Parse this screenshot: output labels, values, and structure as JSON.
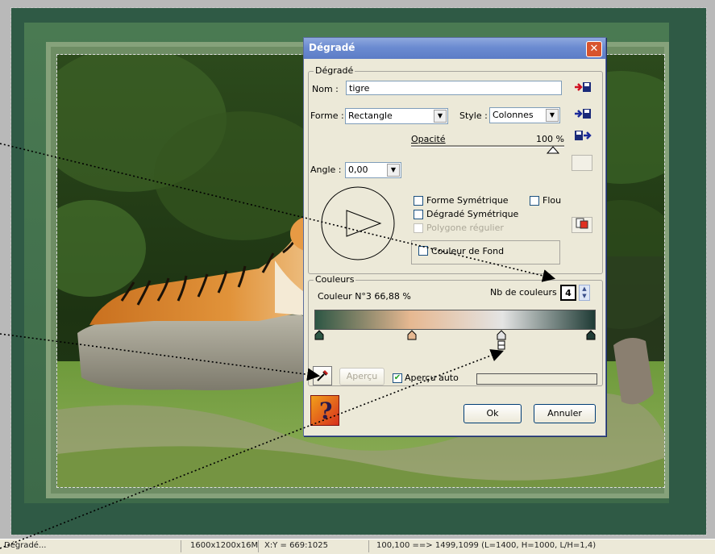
{
  "dialog": {
    "title": "Dégradé",
    "close_label": "✕",
    "gradient_group": {
      "label": "Dégradé",
      "name_label": "Nom :",
      "name_value": "tigre",
      "shape_label": "Forme :",
      "shape_value": "Rectangle",
      "style_label": "Style :",
      "style_value": "Colonnes",
      "opacity_label": "Opacité",
      "opacity_value": "100 %",
      "angle_label": "Angle :",
      "angle_value": "0,00",
      "symmetric_shape_label": "Forme Symétrique",
      "symmetric_shape_checked": false,
      "blur_label": "Flou",
      "blur_checked": false,
      "symmetric_gradient_label": "Dégradé Symétrique",
      "symmetric_gradient_checked": false,
      "regular_polygon_label": "Polygone régulier",
      "regular_polygon_checked": false,
      "background_color_label": "Couleur de Fond",
      "background_color_checked": false
    },
    "colors_group": {
      "label": "Couleurs",
      "current_color_text": "Couleur N°3 66,88 %",
      "count_label": "Nb de couleurs :",
      "count_value": "4",
      "stops": [
        {
          "position": 0,
          "color": "#2d5644"
        },
        {
          "position": 34,
          "color": "#e6b891"
        },
        {
          "position": 67,
          "color": "#e4e4e4"
        },
        {
          "position": 100,
          "color": "#1f3b35"
        }
      ]
    },
    "preview_button": "Aperçu",
    "auto_preview_label": "Aperçu auto",
    "auto_preview_checked": true,
    "ok_button": "Ok",
    "cancel_button": "Annuler",
    "icons": {
      "save": "save-icon",
      "save2": "save-icon",
      "load": "load-icon",
      "copy": "copy-icon",
      "eyedropper": "eyedropper-icon",
      "help": "help-icon"
    },
    "check_mark": "✔"
  },
  "statusbar": {
    "mode": "Dégradé...",
    "image_info": "1600x1200x16M",
    "cursor": "X:Y = 669:1025",
    "selection": "100,100 ==> 1499,1099 (L=1400, H=1000, L/H=1,4)"
  },
  "colors": {
    "frame_dark": "#2f5a45",
    "frame_mat": "#6e8d64",
    "dialog_bg": "#ece9d8",
    "titlebar": "#6b8bd1"
  }
}
